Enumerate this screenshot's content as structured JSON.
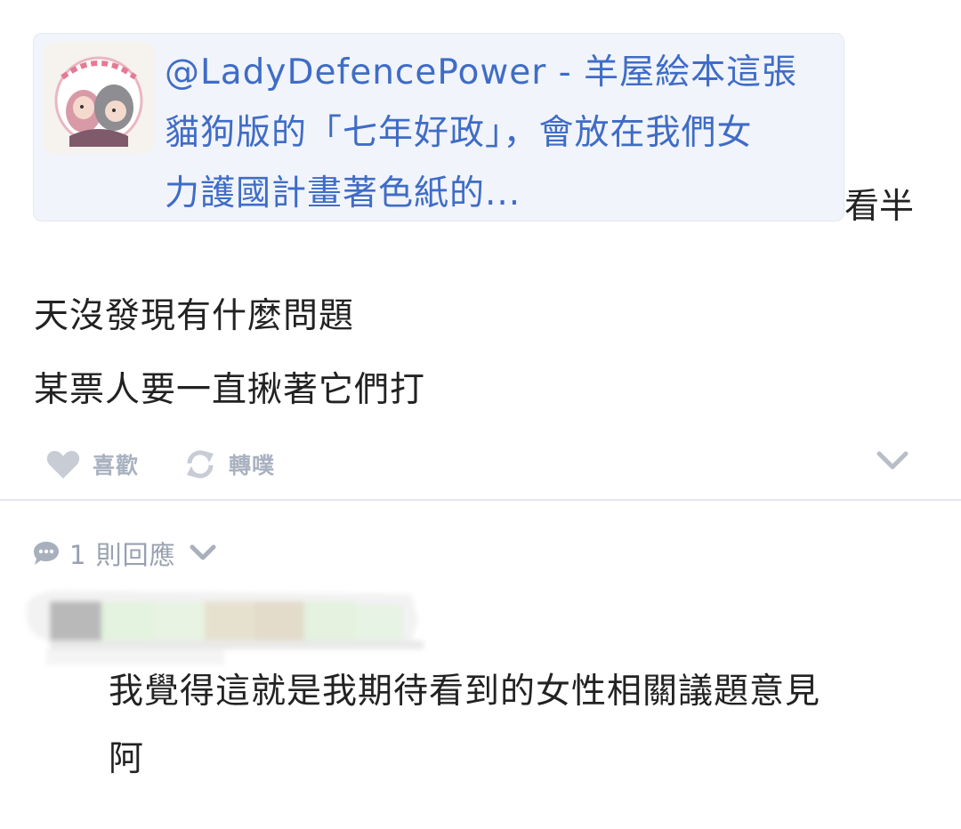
{
  "post": {
    "mention": {
      "line1": "@LadyDefencePower - 羊屋絵本這張",
      "line2": "貓狗版的「七年好政」，會放在我們女",
      "line3": "力護國計畫著色紙的..."
    },
    "trailing_text": "看半",
    "lines": [
      "天沒發現有什麼問題",
      "某票人要一直揪著它們打"
    ]
  },
  "actions": {
    "like_label": "喜歡",
    "repost_label": "轉噗"
  },
  "replies": {
    "count_label": "1 則回應"
  },
  "reply": {
    "lines": [
      "我覺得這就是我期待看到的女性相關議題意見",
      "阿"
    ]
  },
  "colors": {
    "link": "#3f6cc7",
    "card_bg": "#f1f4fa",
    "muted": "#a9b2c0",
    "text": "#222222"
  },
  "icons": {
    "like": "heart-icon",
    "repost": "repost-icon",
    "more": "chevron-down-icon",
    "comment": "speech-bubble-icon"
  }
}
